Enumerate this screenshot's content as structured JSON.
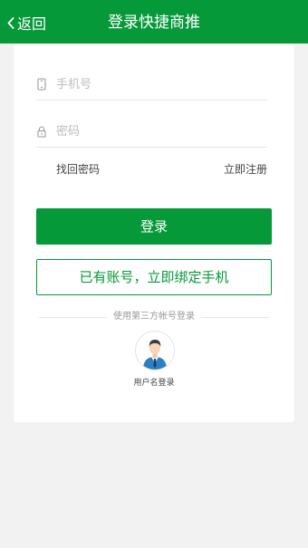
{
  "header": {
    "back_label": "返回",
    "title": "登录快捷商推",
    "background_color": "#06993a"
  },
  "form": {
    "phone_placeholder": "手机号",
    "phone_icon": "phone-icon",
    "password_placeholder": "密码",
    "password_icon": "lock-icon",
    "forgot_password": "找回密码",
    "register": "立即注册"
  },
  "actions": {
    "login_label": "登录",
    "bind_label": "已有账号，立即绑定手机"
  },
  "third_party": {
    "divider_text": "使用第三方帐号登录",
    "username_login_label": "用户名登录",
    "avatar_icon": "user-avatar-icon"
  }
}
